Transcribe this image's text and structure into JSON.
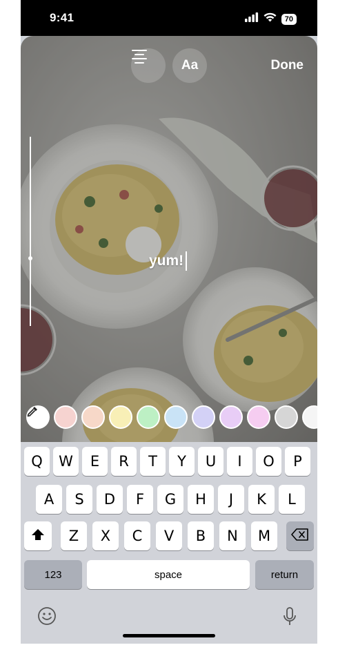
{
  "status_bar": {
    "time": "9:41",
    "battery": "70"
  },
  "editor": {
    "done_label": "Done",
    "font_button_label": "Aa",
    "text_content": "yum!"
  },
  "color_palette": [
    "#f6d3d0",
    "#f7d8c8",
    "#f8efb6",
    "#bdf0c4",
    "#c9e3f6",
    "#d3d1f6",
    "#e8cdf6",
    "#f6cdf1",
    "#d6d6d6",
    "#f5f5f5"
  ],
  "keyboard": {
    "row1": [
      "Q",
      "W",
      "E",
      "R",
      "T",
      "Y",
      "U",
      "I",
      "O",
      "P"
    ],
    "row2": [
      "A",
      "S",
      "D",
      "F",
      "G",
      "H",
      "J",
      "K",
      "L"
    ],
    "row3": [
      "Z",
      "X",
      "C",
      "V",
      "B",
      "N",
      "M"
    ],
    "numbers_label": "123",
    "space_label": "space",
    "return_label": "return"
  }
}
